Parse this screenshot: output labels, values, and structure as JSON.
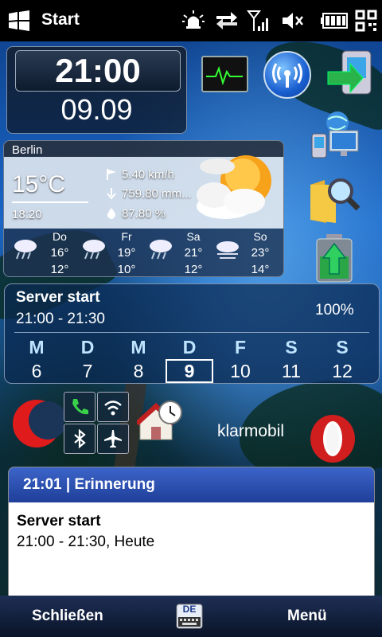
{
  "statusbar": {
    "title": "Start",
    "icons": [
      "windows-logo-icon",
      "notification-bell-icon",
      "sync-arrows-icon",
      "signal-icon",
      "volume-muted-icon",
      "battery-icon",
      "qr-code-icon"
    ]
  },
  "clock": {
    "time": "21:00",
    "date": "09.09"
  },
  "weather": {
    "city": "Berlin",
    "temperature": "15°C",
    "time": "18:20",
    "wind": "5.40 km/h",
    "pressure": "759.80 mm...",
    "humidity": "87.80 %",
    "forecast": [
      {
        "day": "Do",
        "high": "16°",
        "low": "12°",
        "icon": "rain-cloud-icon"
      },
      {
        "day": "Fr",
        "high": "19°",
        "low": "10°",
        "icon": "rain-cloud-icon"
      },
      {
        "day": "Sa",
        "high": "21°",
        "low": "12°",
        "icon": "rain-cloud-icon"
      },
      {
        "day": "So",
        "high": "23°",
        "low": "14°",
        "icon": "fog-cloud-icon"
      }
    ]
  },
  "calendar": {
    "event": "Server start",
    "range": "21:00 - 21:30",
    "percent": "100%",
    "weekdays": [
      "M",
      "D",
      "M",
      "D",
      "F",
      "S",
      "S"
    ],
    "days": [
      "6",
      "7",
      "8",
      "9",
      "10",
      "11",
      "12"
    ],
    "today": "9"
  },
  "apps": {
    "carrier": "klarmobil",
    "icons": [
      "activity-monitor-icon",
      "wireless-broadcast-icon",
      "sync-device-icon",
      "network-computer-icon",
      "search-folder-icon",
      "battery-upgrade-icon",
      "moon-app-icon",
      "phone-toggle-icon",
      "wifi-toggle-icon",
      "bluetooth-toggle-icon",
      "flight-mode-icon",
      "home-clock-icon",
      "opera-browser-icon"
    ]
  },
  "notification": {
    "header": "21:01 | Erinnerung",
    "title": "Server start",
    "time": "21:00 - 21:30, Heute"
  },
  "bottombar": {
    "left": "Schließen",
    "keyboard": "DE",
    "right": "Menü"
  },
  "colors": {
    "accent_blue": "#2a4fb8",
    "day_letters": "#bfe4ff",
    "opera_red": "#cc1b1b"
  }
}
